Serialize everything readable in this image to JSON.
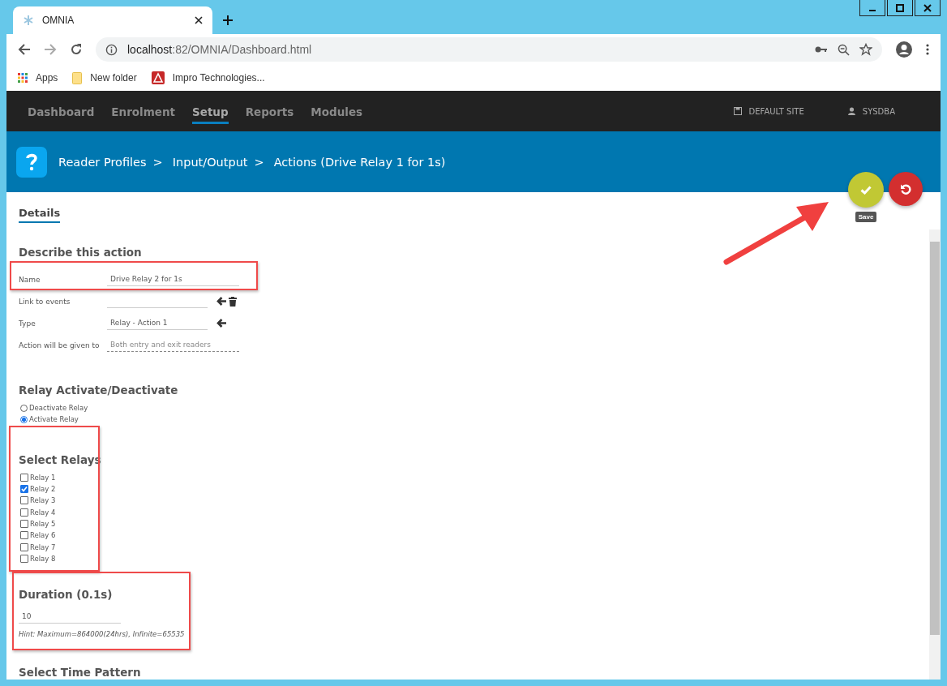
{
  "browser": {
    "tab_title": "OMNIA",
    "url_host": "localhost",
    "url_path": ":82/OMNIA/Dashboard.html",
    "bookmarks": [
      {
        "label": "Apps",
        "kind": "apps"
      },
      {
        "label": "New folder",
        "kind": "folder"
      },
      {
        "label": "Impro Technologies...",
        "kind": "site"
      }
    ]
  },
  "nav": {
    "items": [
      {
        "label": "Dashboard",
        "selected": false
      },
      {
        "label": "Enrolment",
        "selected": false
      },
      {
        "label": "Setup",
        "selected": true
      },
      {
        "label": "Reports",
        "selected": false
      },
      {
        "label": "Modules",
        "selected": false
      }
    ],
    "site": "DEFAULT SITE",
    "user": "SYSDBA"
  },
  "breadcrumb": [
    {
      "kind": "crumb",
      "label": "Reader Profiles"
    },
    {
      "kind": "separator",
      "label": ">"
    },
    {
      "kind": "crumb",
      "label": "Input/Output"
    },
    {
      "kind": "separator",
      "label": ">"
    },
    {
      "kind": "crumb",
      "label": "Actions (Drive Relay 1 for 1s)"
    }
  ],
  "actions": {
    "save_tooltip": "Save"
  },
  "tabs": [
    {
      "label": "Details",
      "selected": true
    }
  ],
  "describe": {
    "heading": "Describe this action",
    "fields": [
      {
        "label": "Name",
        "kind": "text",
        "value": "Drive Relay 2 for 1s"
      },
      {
        "label": "Link to events",
        "kind": "link"
      },
      {
        "label": "Type",
        "kind": "lookup",
        "value": "Relay - Action 1"
      },
      {
        "label": "Action will be given to",
        "kind": "select",
        "placeholder": "Both entry and exit readers"
      }
    ]
  },
  "relay_mode": {
    "heading": "Relay Activate/Deactivate",
    "options": [
      {
        "label": "Deactivate Relay",
        "selected": false
      },
      {
        "label": "Activate Relay",
        "selected": true
      }
    ]
  },
  "relays": {
    "heading": "Select Relays",
    "items": [
      {
        "label": "Relay 1",
        "checked": false
      },
      {
        "label": "Relay 2",
        "checked": true
      },
      {
        "label": "Relay 3",
        "checked": false
      },
      {
        "label": "Relay 4",
        "checked": false
      },
      {
        "label": "Relay 5",
        "checked": false
      },
      {
        "label": "Relay 6",
        "checked": false
      },
      {
        "label": "Relay 7",
        "checked": false
      },
      {
        "label": "Relay 8",
        "checked": false
      }
    ]
  },
  "duration": {
    "heading": "Duration (0.1s)",
    "value": "10",
    "hint": "Hint: Maximum=864000(24hrs), Infinite=65535"
  },
  "time_pattern": {
    "heading": "Select Time Pattern"
  }
}
